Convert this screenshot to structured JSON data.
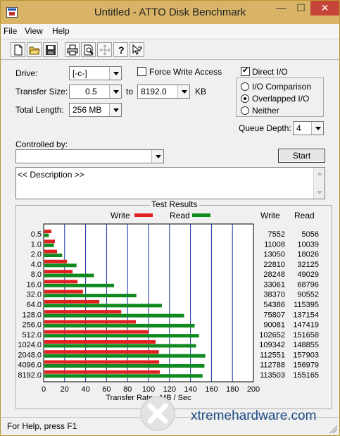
{
  "window": {
    "title": "Untitled - ATTO Disk Benchmark",
    "controls": {
      "minimize": "—",
      "maximize": "☐",
      "close": "✕"
    }
  },
  "menu": [
    "File",
    "View",
    "Help"
  ],
  "toolbar": [
    "new-icon",
    "open-icon",
    "save-icon",
    "print-icon",
    "print-preview-icon",
    "move-icon",
    "help-icon",
    "context-help-icon"
  ],
  "form": {
    "drive_label": "Drive:",
    "drive_value": "[-c-]",
    "transfer_size_label": "Transfer Size:",
    "transfer_size_from": "0.5",
    "to_label": "to",
    "transfer_size_to": "8192.0",
    "kb_label": "KB",
    "total_length_label": "Total Length:",
    "total_length_value": "256 MB",
    "force_write_label": "Force Write Access",
    "direct_io_label": "Direct I/O",
    "io_comparison_label": "I/O Comparison",
    "overlapped_io_label": "Overlapped I/O",
    "neither_label": "Neither",
    "queue_depth_label": "Queue Depth:",
    "queue_depth_value": "4",
    "controlled_by_label": "Controlled by:",
    "controlled_by_value": "",
    "start_label": "Start",
    "description_text": "<< Description >>",
    "force_write_checked": false,
    "direct_io_checked": true,
    "io_mode_selected": "Overlapped I/O"
  },
  "results": {
    "title": "Test Results",
    "legend_write": "Write",
    "legend_read": "Read",
    "col_write": "Write",
    "col_read": "Read",
    "write_color": "#e02020",
    "read_color": "#0f8a1e"
  },
  "chart_data": {
    "type": "bar",
    "orientation": "horizontal",
    "title": "Test Results",
    "xlabel": "Transfer Rate - MB / Sec",
    "xlim": [
      0,
      200
    ],
    "xticks": [
      0,
      20,
      40,
      60,
      80,
      100,
      120,
      140,
      160,
      180,
      200
    ],
    "categories": [
      "0.5",
      "1.0",
      "2.0",
      "4.0",
      "8.0",
      "16.0",
      "32.0",
      "64.0",
      "128.0",
      "256.0",
      "512.0",
      "1024.0",
      "2048.0",
      "4096.0",
      "8192.0"
    ],
    "series": [
      {
        "name": "Write",
        "color": "#e02020",
        "values": [
          7552,
          11008,
          13050,
          22810,
          28248,
          33061,
          38370,
          54386,
          75807,
          90081,
          102652,
          109342,
          112551,
          112788,
          113503
        ]
      },
      {
        "name": "Read",
        "color": "#0f8a1e",
        "values": [
          5056,
          10039,
          18026,
          32125,
          49029,
          68796,
          90552,
          115395,
          137154,
          147419,
          151658,
          148855,
          157903,
          156979,
          155165
        ]
      }
    ],
    "value_unit": "KB/s"
  },
  "statusbar": {
    "text": "For Help, press F1"
  },
  "watermark": {
    "text": "xtremehardware.com"
  }
}
